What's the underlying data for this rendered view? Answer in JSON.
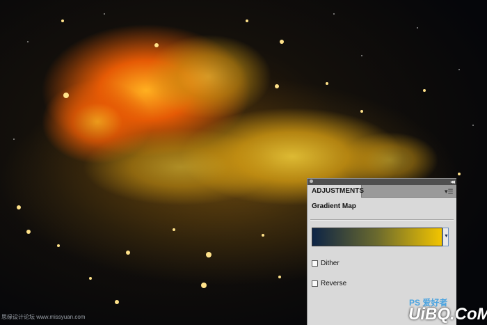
{
  "panel": {
    "tab_label": "ADJUSTMENTS",
    "collapse_glyph": "◂◂",
    "menu_glyph": "▾☰",
    "adjustment_title": "Gradient Map",
    "gradient": {
      "start_color": "#0d2446",
      "mid_color": "#6b6a2e",
      "end_color": "#f2c400"
    },
    "dither_label": "Dither",
    "dither_checked": false,
    "reverse_label": "Reverse",
    "reverse_checked": false
  },
  "watermark": {
    "left_text": "思缘设计论坛 www.missyuan.com",
    "right_text": "UiBQ.CoM",
    "right_sub": "PS 爱好者"
  }
}
